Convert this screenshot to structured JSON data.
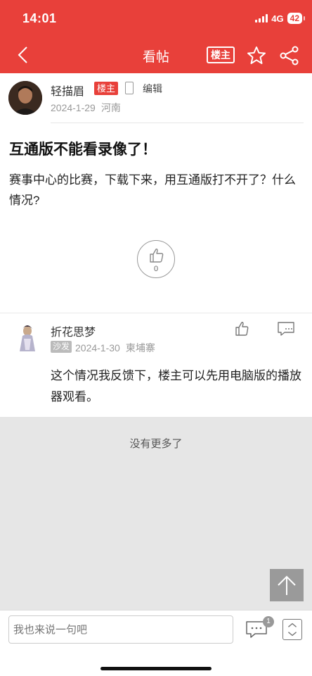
{
  "status_bar": {
    "time": "14:01",
    "network": "4G",
    "battery": "42"
  },
  "nav": {
    "title": "看帖",
    "owner_button": "楼主"
  },
  "post": {
    "author": "轻描眉",
    "owner_badge": "楼主",
    "edit_label": "编辑",
    "date": "2024-1-29",
    "location": "河南",
    "title": "互通版不能看录像了！",
    "body": "赛事中心的比赛，下载下来，用互通版打不开了？什么情况?",
    "like_count": "0"
  },
  "reply": {
    "author": "折花思梦",
    "badge": "沙发",
    "date": "2024-1-30",
    "location": "柬埔寨",
    "body": "这个情况我反馈下，楼主可以先用电脑版的播放器观看。"
  },
  "footer": {
    "no_more": "没有更多了",
    "input_placeholder": "我也来说一句吧",
    "comment_count": "1"
  },
  "colors": {
    "brand": "#e8403a",
    "muted": "#999999",
    "background": "#e6e6e6"
  }
}
